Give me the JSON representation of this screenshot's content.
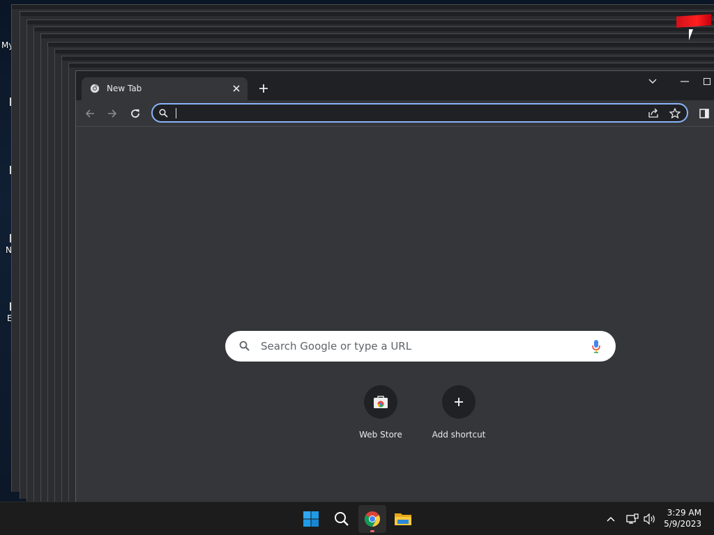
{
  "desktop": {
    "icon_labels": [
      "My",
      "N",
      "E"
    ]
  },
  "browser": {
    "tab": {
      "title": "New Tab"
    },
    "omnibox": {
      "value": "",
      "placeholder": ""
    },
    "ntp": {
      "search_placeholder": "Search Google or type a URL",
      "shortcuts": [
        {
          "label": "Web Store",
          "icon": "webstore-icon"
        },
        {
          "label": "Add shortcut",
          "icon": "plus-icon"
        }
      ]
    },
    "theme": {
      "accent": "#8ab4f8",
      "background": "#35363a",
      "tabstrip": "#202124"
    }
  },
  "taskbar": {
    "apps": [
      {
        "name": "start",
        "icon": "windows-logo-icon"
      },
      {
        "name": "search",
        "icon": "search-icon"
      },
      {
        "name": "chrome",
        "icon": "chrome-icon",
        "active": true
      },
      {
        "name": "file-explorer",
        "icon": "folder-icon"
      }
    ],
    "clock": {
      "time": "3:29 AM",
      "date": "5/9/2023"
    }
  }
}
